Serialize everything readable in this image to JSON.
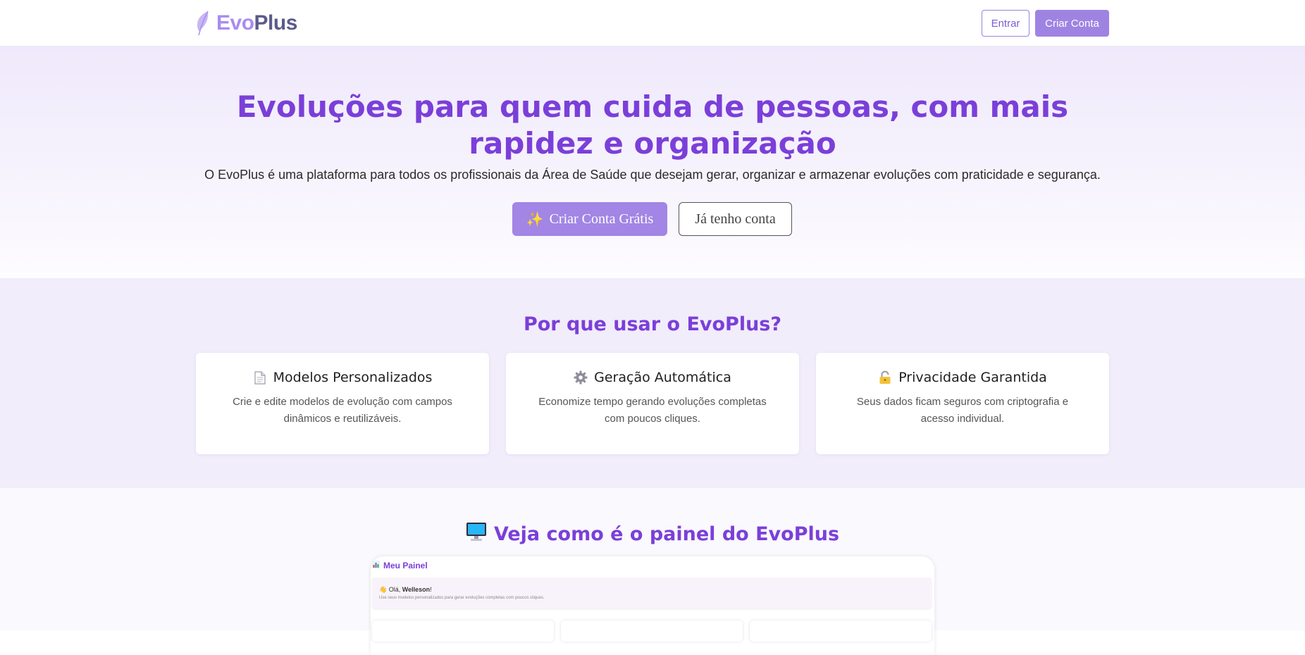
{
  "header": {
    "logo_evo": "Evo",
    "logo_plus": "Plus",
    "login_label": "Entrar",
    "signup_label": "Criar Conta"
  },
  "hero": {
    "title": "Evoluções para quem cuida de pessoas, com mais rapidez e organização",
    "subtitle": "O EvoPlus é uma plataforma para todos os profissionais da Área de Saúde que desejam gerar, organizar e armazenar evoluções com praticidade e segurança.",
    "primary_label": "Criar Conta Grátis",
    "secondary_label": "Já tenho conta"
  },
  "features": {
    "title": "Por que usar o EvoPlus?",
    "items": [
      {
        "icon": "document-icon",
        "title": "Modelos Personalizados",
        "desc": "Crie e edite modelos de evolução com campos dinâmicos e reutilizáveis."
      },
      {
        "icon": "gear-icon",
        "title": "Geração Automática",
        "desc": "Economize tempo gerando evoluções completas com poucos cliques."
      },
      {
        "icon": "lock-icon",
        "title": "Privacidade Garantida",
        "desc": "Seus dados ficam seguros com criptografia e acesso individual."
      }
    ]
  },
  "preview": {
    "title_prefix": "Veja como é o painel do ",
    "title_brand": "EvoPlus",
    "mock": {
      "header": "Meu Painel",
      "greeting": "Olá, ",
      "user": "Welleson",
      "greeting_end": "!",
      "hint": "Use seus modelos personalizados para gerar evoluções completas com poucos cliques."
    }
  },
  "colors": {
    "accent": "#7b3fd9",
    "button": "#a285e5",
    "features_bg": "#f1edfb"
  }
}
